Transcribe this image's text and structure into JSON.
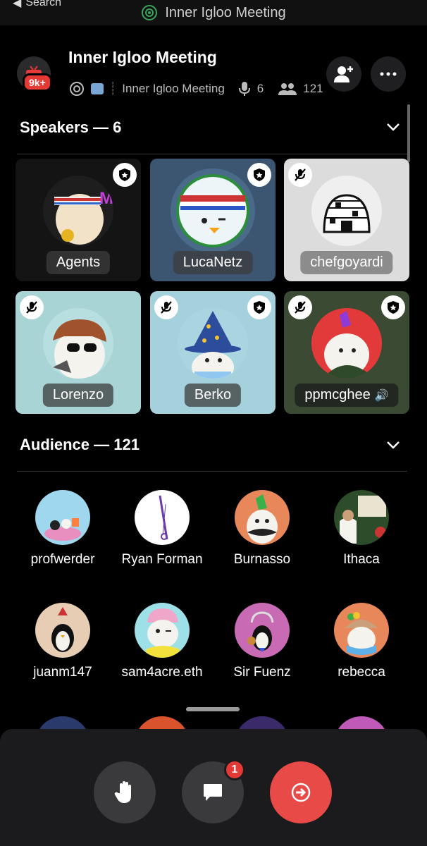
{
  "top": {
    "back_label": "Search",
    "title": "Inner Igloo Meeting"
  },
  "header": {
    "title": "Inner Igloo Meeting",
    "badge": "9k+",
    "channel_name": "Inner Igloo Meeting",
    "speaker_count": "6",
    "listener_count": "121"
  },
  "speakers": {
    "heading": "Speakers — 6",
    "tiles": [
      {
        "name": "Agents",
        "bg": "#141414",
        "muted": false,
        "mod": true
      },
      {
        "name": "LucaNetz",
        "bg": "#3c5571",
        "muted": false,
        "mod": true
      },
      {
        "name": "chefgoyardi",
        "bg": "#dcdcdc",
        "muted": true,
        "mod": false
      },
      {
        "name": "Lorenzo",
        "bg": "#a9d4d6",
        "muted": true,
        "mod": false
      },
      {
        "name": "Berko",
        "bg": "#a4d1dc",
        "muted": true,
        "mod": true
      },
      {
        "name": "ppmcghee",
        "name_suffix": "🔊",
        "bg": "#3a4a33",
        "muted": true,
        "mod": true
      }
    ]
  },
  "audience": {
    "heading": "Audience — 121",
    "members": [
      {
        "name": "profwerder",
        "color": "#9fd7ee"
      },
      {
        "name": "Ryan Forman",
        "color": "#ffffff"
      },
      {
        "name": "Burnasso",
        "color": "#e8875a"
      },
      {
        "name": "Ithaca",
        "color": "#2d4d2a"
      },
      {
        "name": "juanm147",
        "color": "#e6cdb4"
      },
      {
        "name": "sam4acre.eth",
        "color": "#9ee0e8"
      },
      {
        "name": "Sir Fuenz",
        "color": "#c86ab4"
      },
      {
        "name": "rebecca",
        "color": "#e8875a"
      }
    ]
  },
  "bottom": {
    "chat_badge": "1"
  }
}
